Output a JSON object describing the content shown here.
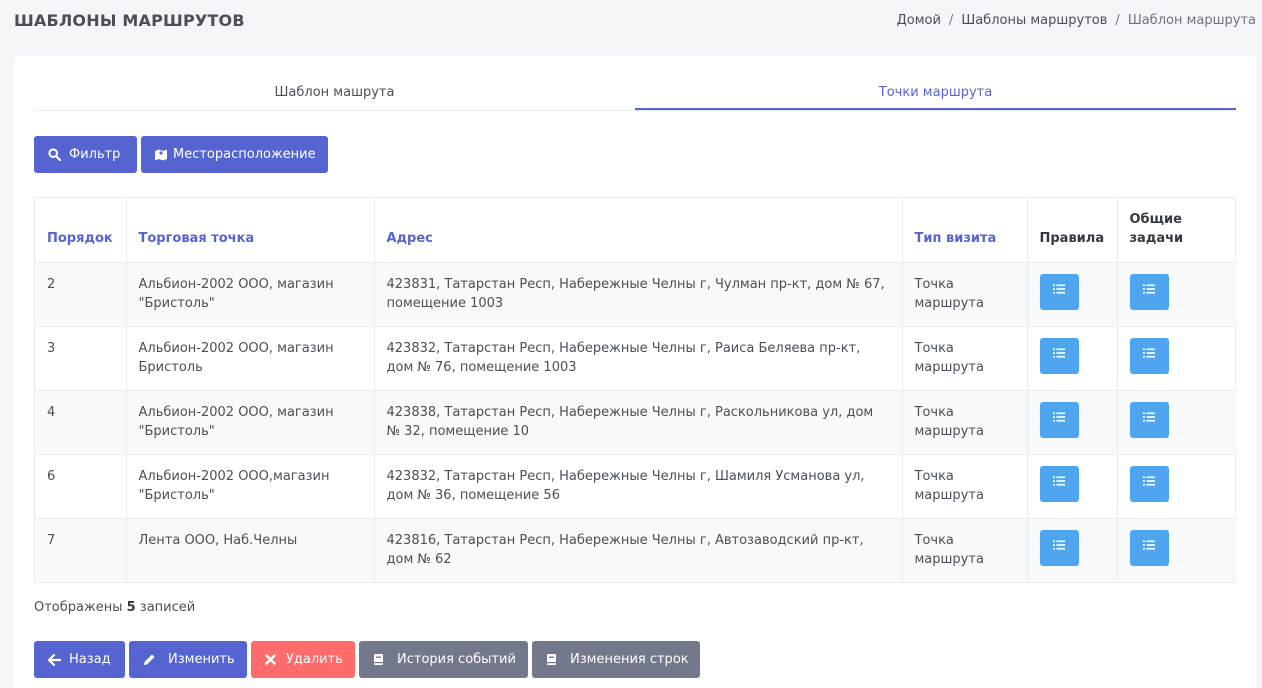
{
  "header": {
    "title": "ШАБЛОНЫ МАРШРУТОВ",
    "breadcrumb": [
      "Домой",
      "Шаблоны маршрутов",
      "Шаблон маршрута"
    ],
    "separator": "/"
  },
  "tabs": [
    {
      "label": "Шаблон машрута",
      "active": false
    },
    {
      "label": "Точки маршрута",
      "active": true
    }
  ],
  "toolbar": {
    "filter_label": "Фильтр",
    "location_label": "Месторасположение"
  },
  "table": {
    "columns": [
      "Порядок",
      "Торговая точка",
      "Адрес",
      "Тип визита",
      "Правила",
      "Общие задачи"
    ],
    "rows": [
      {
        "order": "2",
        "outlet": "Альбион-2002 ООО, магазин \"Бристоль\"",
        "address": "423831, Татарстан Респ, Набережные Челны г, Чулман пр-кт, дом № 67, помещение 1003",
        "visit_type": "Точка маршрута"
      },
      {
        "order": "3",
        "outlet": "Альбион-2002 ООО, магазин Бристоль",
        "address": "423832, Татарстан Респ, Набережные Челны г, Раиса Беляева пр-кт, дом № 76, помещение 1003",
        "visit_type": "Точка маршрута"
      },
      {
        "order": "4",
        "outlet": "Альбион-2002 ООО, магазин \"Бристоль\"",
        "address": "423838, Татарстан Респ, Набережные Челны г, Раскольникова ул, дом № 32, помещение 10",
        "visit_type": "Точка маршрута"
      },
      {
        "order": "6",
        "outlet": "Альбион-2002 ООО,магазин \"Бристоль\"",
        "address": "423832, Татарстан Респ, Набережные Челны г, Шамиля Усманова ул, дом № 36, помещение 56",
        "visit_type": "Точка маршрута"
      },
      {
        "order": "7",
        "outlet": "Лента ООО, Наб.Челны",
        "address": "423816, Татарстан Респ, Набережные Челны г, Автозаводский пр-кт, дом № 62",
        "visit_type": "Точка маршрута"
      }
    ]
  },
  "footer": {
    "shown_prefix": "Отображены",
    "shown_count": "5",
    "shown_suffix": "записей"
  },
  "actions": {
    "back_label": "Назад",
    "edit_label": "Изменить",
    "delete_label": "Удалить",
    "history_label": "История событий",
    "row_changes_label": "Изменения строк"
  },
  "colors": {
    "primary": "#5664d2",
    "info": "#50a5f1",
    "danger": "#ff6b6b",
    "secondary": "#74788d"
  },
  "icons": {
    "filter": "search-icon",
    "location": "map-icon",
    "rules": "list-icon",
    "tasks": "list-icon",
    "back": "arrow-left-icon",
    "edit": "pencil-icon",
    "delete": "close-icon",
    "history": "book-icon",
    "row_changes": "book-icon"
  }
}
